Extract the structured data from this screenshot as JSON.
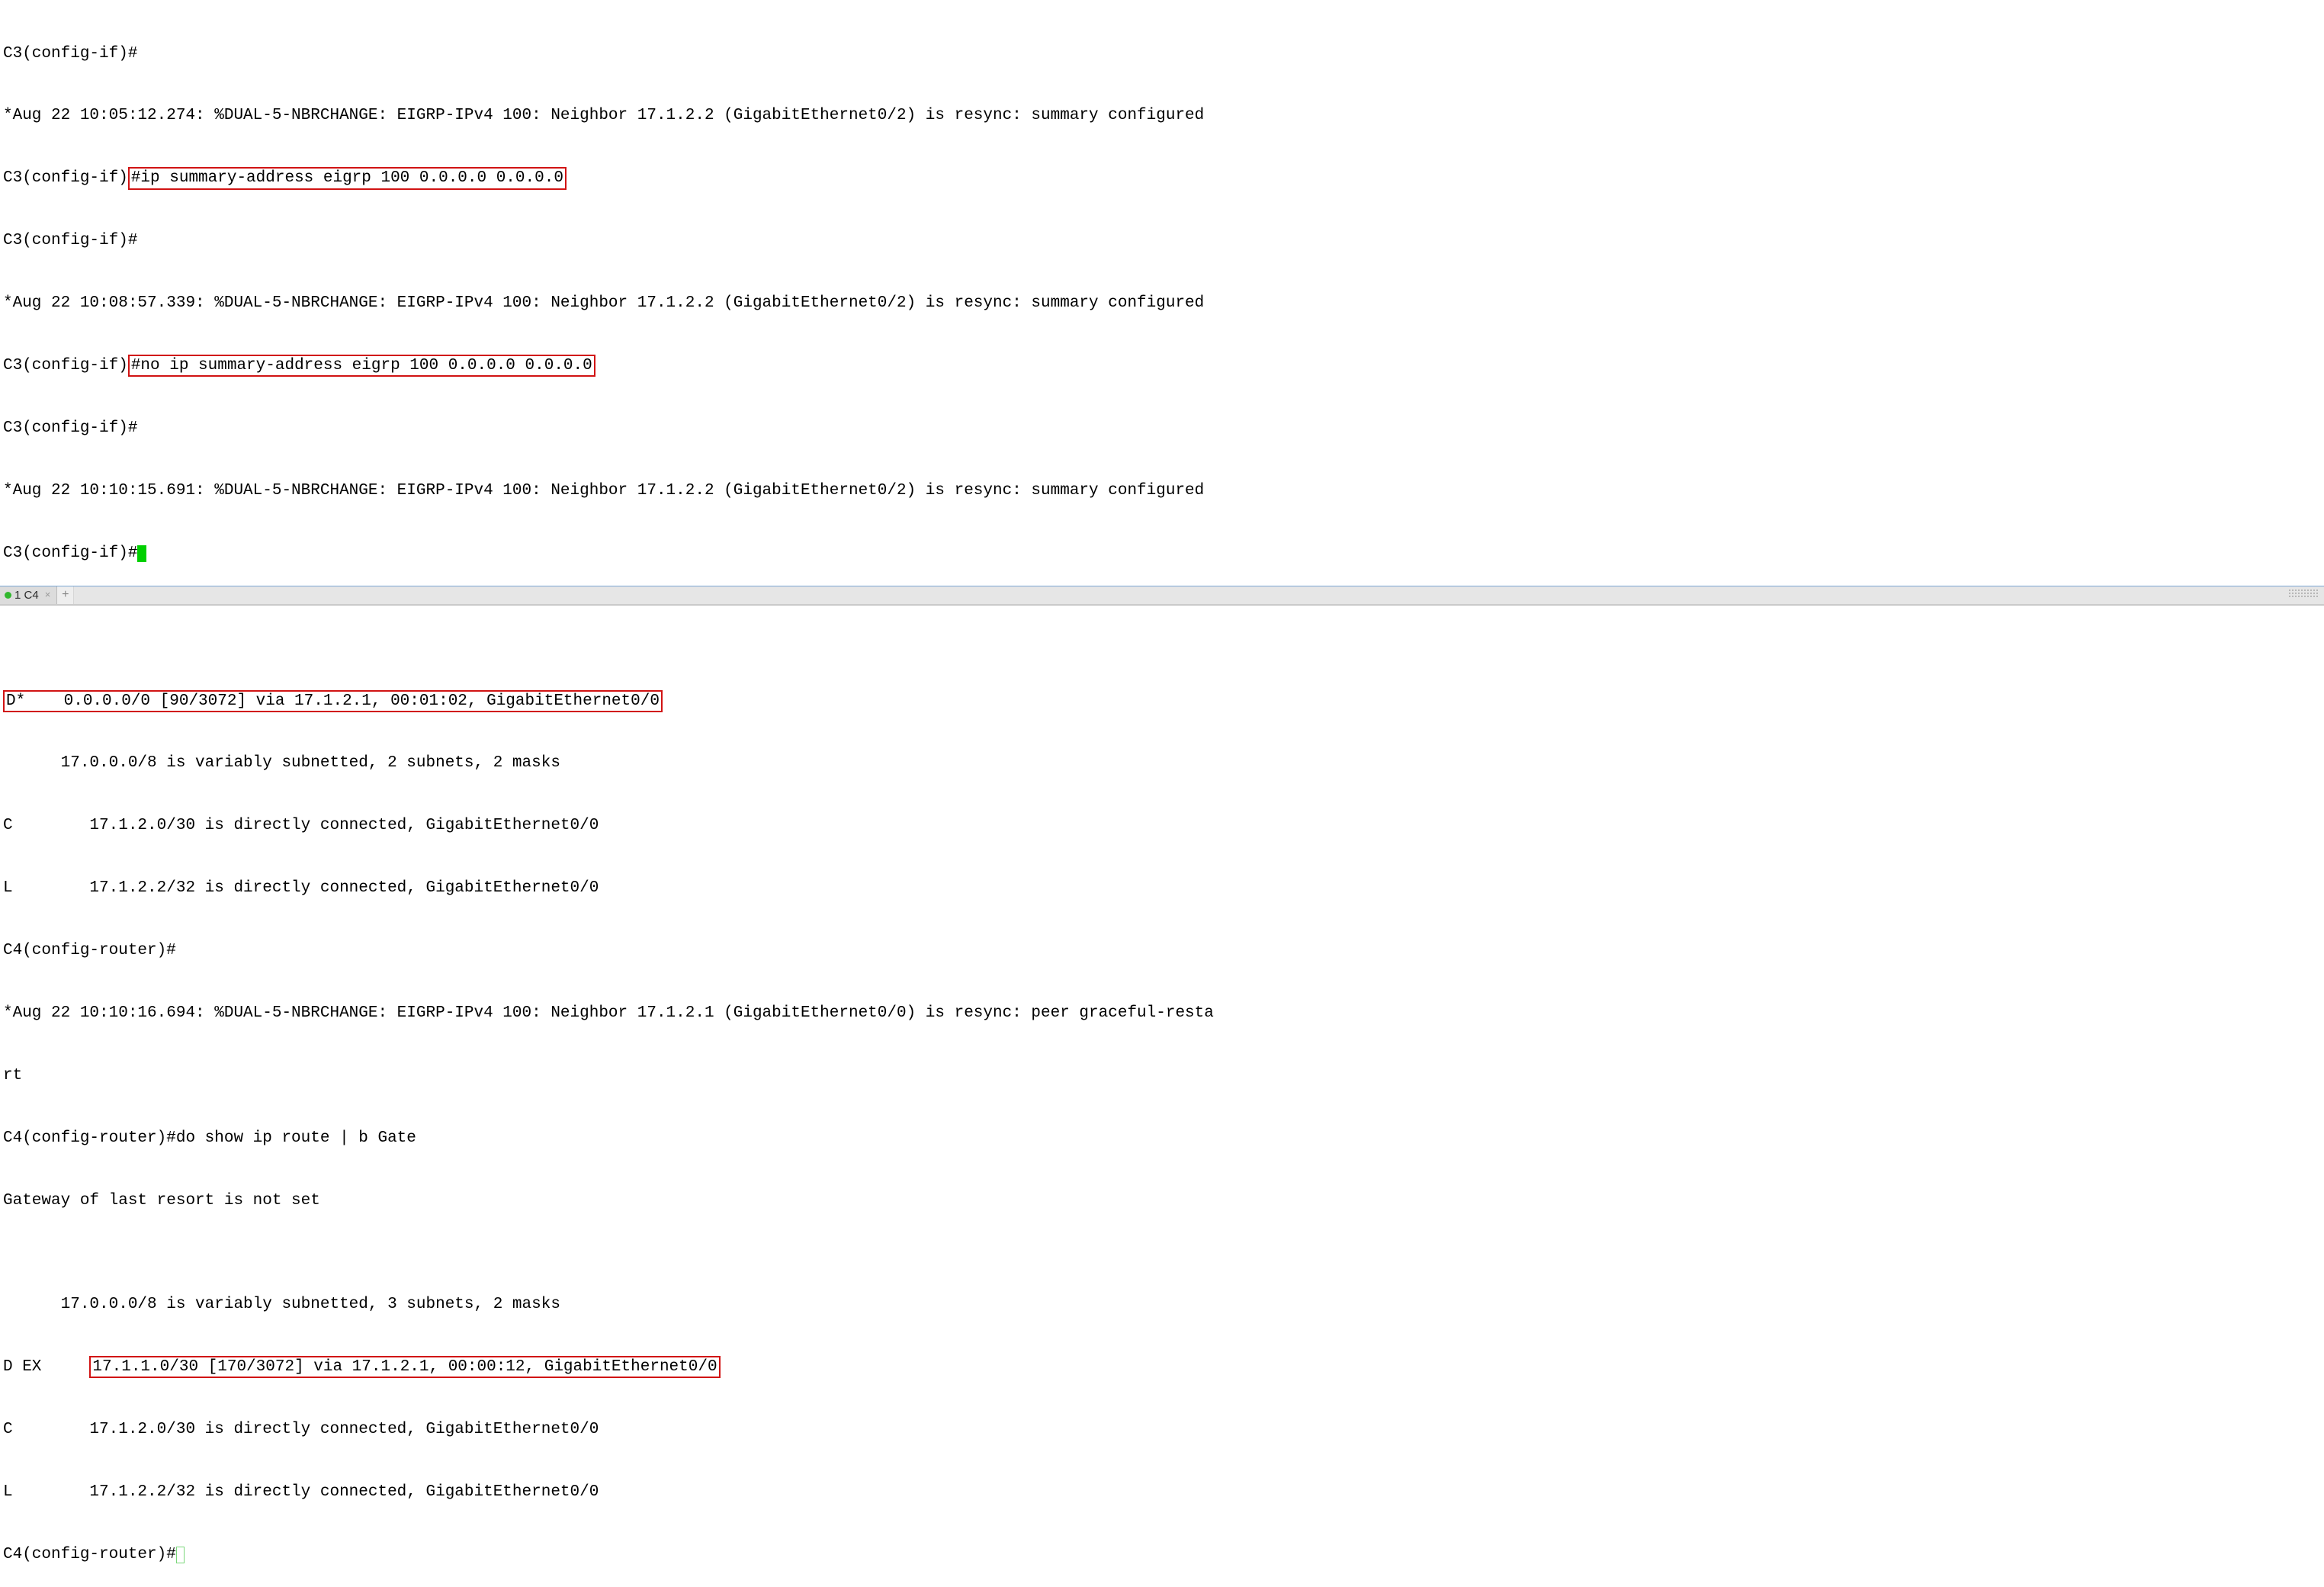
{
  "top": {
    "l1": "C3(config-if)#",
    "l2": "*Aug 22 10:05:12.274: %DUAL-5-NBRCHANGE: EIGRP-IPv4 100: Neighbor 17.1.2.2 (GigabitEthernet0/2) is resync: summary configured",
    "l3_prefix": "C3(config-if)",
    "l3_box": "#ip summary-address eigrp 100 0.0.0.0 0.0.0.0",
    "l4": "C3(config-if)#",
    "l5": "*Aug 22 10:08:57.339: %DUAL-5-NBRCHANGE: EIGRP-IPv4 100: Neighbor 17.1.2.2 (GigabitEthernet0/2) is resync: summary configured",
    "l6_prefix": "C3(config-if)",
    "l6_box": "#no ip summary-address eigrp 100 0.0.0.0 0.0.0.0",
    "l7": "C3(config-if)#",
    "l8": "*Aug 22 10:10:15.691: %DUAL-5-NBRCHANGE: EIGRP-IPv4 100: Neighbor 17.1.2.2 (GigabitEthernet0/2) is resync: summary configured",
    "l9": "C3(config-if)#"
  },
  "tab": {
    "label": "1 C4",
    "close": "×",
    "add": "+"
  },
  "bottom": {
    "blank": "",
    "l1_box": "D*    0.0.0.0/0 [90/3072] via 17.1.2.1, 00:01:02, GigabitEthernet0/0",
    "l2": "      17.0.0.0/8 is variably subnetted, 2 subnets, 2 masks",
    "l3": "C        17.1.2.0/30 is directly connected, GigabitEthernet0/0",
    "l4": "L        17.1.2.2/32 is directly connected, GigabitEthernet0/0",
    "l5": "C4(config-router)#",
    "l6": "*Aug 22 10:10:16.694: %DUAL-5-NBRCHANGE: EIGRP-IPv4 100: Neighbor 17.1.2.1 (GigabitEthernet0/0) is resync: peer graceful-resta",
    "l7": "rt",
    "l8": "C4(config-router)#do show ip route | b Gate",
    "l9": "Gateway of last resort is not set",
    "l11": "      17.0.0.0/8 is variably subnetted, 3 subnets, 2 masks",
    "l12_prefix": "D EX     ",
    "l12_box": "17.1.1.0/30 [170/3072] via 17.1.2.1, 00:00:12, GigabitEthernet0/0",
    "l13": "C        17.1.2.0/30 is directly connected, GigabitEthernet0/0",
    "l14": "L        17.1.2.2/32 is directly connected, GigabitEthernet0/0",
    "l15": "C4(config-router)#"
  }
}
